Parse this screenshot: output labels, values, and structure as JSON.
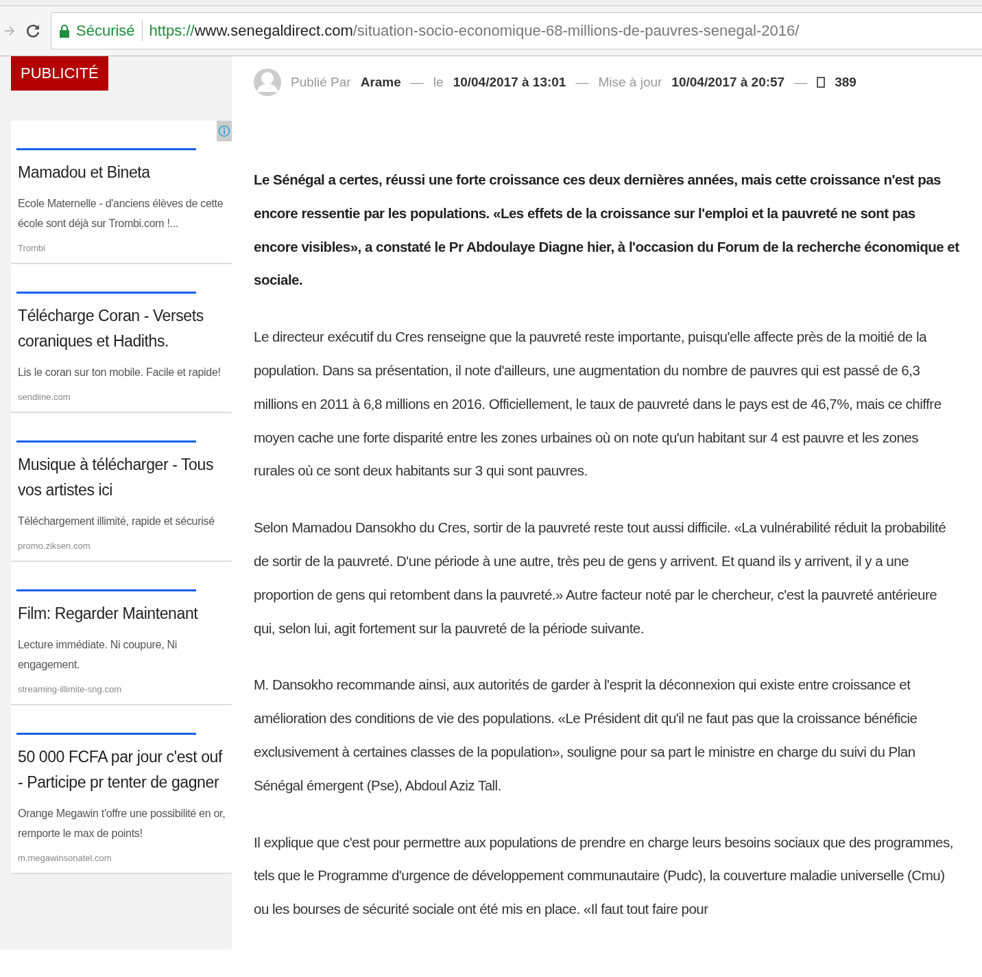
{
  "browser": {
    "security_label": "Sécurisé",
    "url": {
      "scheme": "https://",
      "host": "www.senegaldirect.com",
      "path": "/situation-socio-economique-68-millions-de-pauvres-senegal-2016/"
    }
  },
  "sidebar": {
    "label": "PUBLICITÉ",
    "ads": [
      {
        "title": "Mamadou et Bineta",
        "description": "Ecole Maternelle - d'anciens élèves de cette école sont déjà sur Trombi.com !...",
        "source": "Trombi"
      },
      {
        "title": "Télécharge Coran - Versets coraniques et Hadiths.",
        "description": "Lis le coran sur ton mobile. Facile et rapide!",
        "source": "sendiine.com"
      },
      {
        "title": "Musique à télécharger - Tous vos artistes ici",
        "description": "Téléchargement illimité, rapide et sécurisé",
        "source": "promo.ziksen.com"
      },
      {
        "title": "Film: Regarder Maintenant",
        "description": "Lecture immédiate. Ni coupure, Ni engagement.",
        "source": "streaming-illimite-sng.com"
      },
      {
        "title": "50 000 FCFA par jour c'est ouf - Participe pr tenter de gagner",
        "description": "Orange Megawin t'offre une possibilité en or, remporte le max de points!",
        "source": "m.megawinsonatel.com"
      }
    ]
  },
  "article": {
    "meta": {
      "published_label": "Publié Par",
      "author": "Arame",
      "date_label": "le",
      "date": "10/04/2017 à 13:01",
      "updated_label": "Mise à jour",
      "updated": "10/04/2017 à 20:57",
      "comments": "389",
      "separator": "—"
    },
    "paragraphs": [
      {
        "kind": "lead",
        "text": "Le Sénégal a certes, réussi une forte croissance ces deux dernières années, mais cette croissance n'est pas encore ressentie par les populations. «Les effets de la croissance sur l'emploi et la pauvreté ne sont pas encore visibles», a constaté le Pr Abdoulaye Diagne hier, à l'occasion du Forum de la recherche économique et sociale."
      },
      {
        "kind": "body",
        "text": "Le directeur exécutif du Cres renseigne que la pauvreté reste importante, puisqu'elle affecte près de la moitié de la population. Dans sa présentation, il note d'ailleurs, une augmentation du nombre de pauvres qui est passé de 6,3 millions en 2011 à 6,8 millions en 2016. Officiellement, le taux de pauvreté dans le pays est de 46,7%, mais ce chiffre moyen cache une forte disparité entre les zones urbaines où on note qu'un habitant sur 4 est pauvre et les zones rurales où ce sont deux habitants sur 3 qui sont pauvres."
      },
      {
        "kind": "body",
        "text": "Selon Mamadou Dansokho du Cres, sortir de la pauvreté reste tout aussi difficile. «La vulnérabilité réduit la probabilité de sortir de la pauvreté. D'une période à une autre, très peu de gens y arrivent. Et quand ils y arrivent, il y a une proportion de gens qui retombent dans la pauvreté.» Autre facteur noté par le chercheur, c'est la pauvreté antérieure qui, selon lui, agit fortement sur la pauvreté de la période suivante."
      },
      {
        "kind": "body",
        "text": "M. Dansokho recommande ainsi, aux autorités de garder à l'esprit la déconnexion qui existe entre croissance et amélioration des conditions de vie des populations. «Le Président dit qu'il ne faut pas que la croissance bénéficie exclusivement à certaines classes de la population», souligne pour sa part le ministre en charge du suivi du Plan Sénégal émergent (Pse), Abdoul Aziz Tall."
      },
      {
        "kind": "body",
        "text": "Il explique que c'est pour permettre aux populations de prendre en charge leurs besoins sociaux que des programmes, tels que le Programme d'urgence de développement communautaire (Pudc), la couverture maladie universelle (Cmu) ou les bourses de sécurité sociale ont été mis en place. «Il faut tout faire pour"
      }
    ]
  }
}
